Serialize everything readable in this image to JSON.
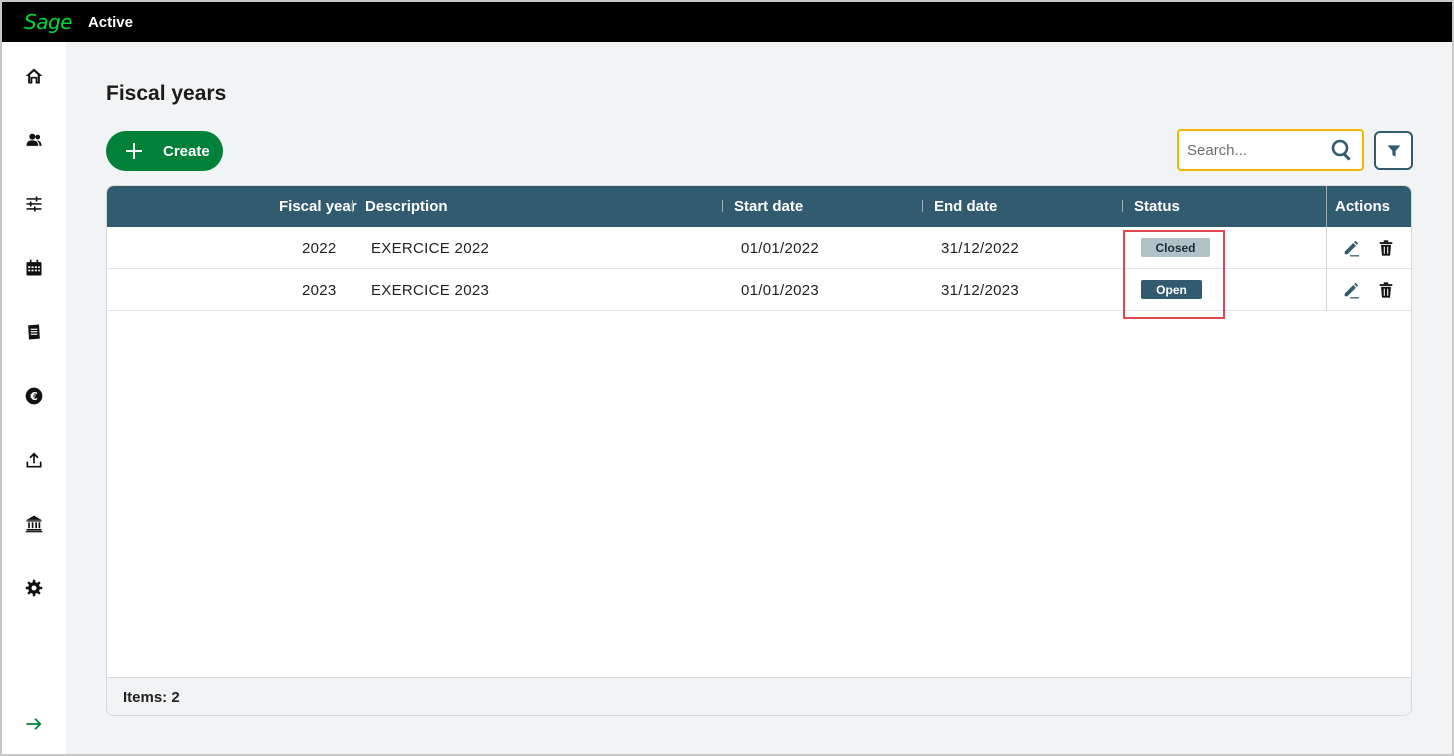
{
  "header": {
    "logo": "Sage",
    "app_name": "Active"
  },
  "sidebar": {
    "icons": [
      "home-icon",
      "users-icon",
      "sliders-icon",
      "calendar-icon",
      "book-icon",
      "euro-icon",
      "upload-icon",
      "bank-icon",
      "gear-icon"
    ],
    "expand_icon": "arrow-right-icon"
  },
  "page": {
    "title": "Fiscal years"
  },
  "toolbar": {
    "create_label": "Create",
    "search_placeholder": "Search...",
    "filter_icon": "filter-icon"
  },
  "table": {
    "columns": {
      "fiscal_year": "Fiscal year",
      "description": "Description",
      "start_date": "Start date",
      "end_date": "End date",
      "status": "Status",
      "actions": "Actions"
    },
    "rows": [
      {
        "fiscal_year": "2022",
        "description": "EXERCICE 2022",
        "start_date": "01/01/2022",
        "end_date": "31/12/2022",
        "status": "Closed"
      },
      {
        "fiscal_year": "2023",
        "description": "EXERCICE 2023",
        "start_date": "01/01/2023",
        "end_date": "31/12/2023",
        "status": "Open"
      }
    ],
    "footer": "Items: 2"
  },
  "colors": {
    "brand_green": "#00813a",
    "logo_green": "#00d639",
    "header_blue": "#335b70",
    "closed_badge": "#b2c0c8",
    "highlight": "#e0464d",
    "search_focus": "#f0b800"
  }
}
